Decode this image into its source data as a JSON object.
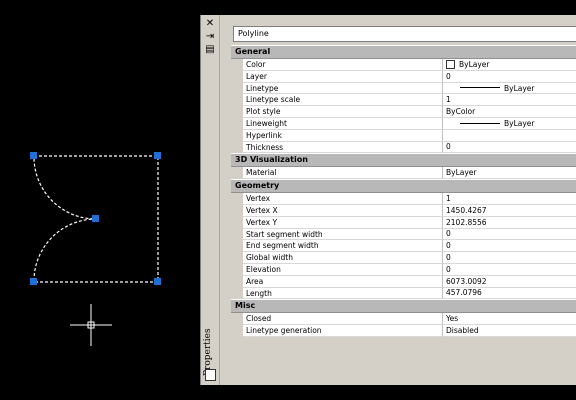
{
  "palette": {
    "title": "Properties",
    "object_type": "Polyline",
    "categories": [
      {
        "name": "General",
        "props": [
          {
            "name": "Color",
            "value": "ByLayer",
            "swatch": true
          },
          {
            "name": "Layer",
            "value": "0"
          },
          {
            "name": "Linetype",
            "value": "ByLayer",
            "line": true
          },
          {
            "name": "Linetype scale",
            "value": "1"
          },
          {
            "name": "Plot style",
            "value": "ByColor"
          },
          {
            "name": "Lineweight",
            "value": "ByLayer",
            "line": true
          },
          {
            "name": "Hyperlink",
            "value": ""
          },
          {
            "name": "Thickness",
            "value": "0"
          }
        ]
      },
      {
        "name": "3D Visualization",
        "props": [
          {
            "name": "Material",
            "value": "ByLayer"
          }
        ]
      },
      {
        "name": "Geometry",
        "props": [
          {
            "name": "Vertex",
            "value": "1"
          },
          {
            "name": "Vertex X",
            "value": "1450.4267"
          },
          {
            "name": "Vertex Y",
            "value": "2102.8556"
          },
          {
            "name": "Start segment width",
            "value": "0"
          },
          {
            "name": "End segment width",
            "value": "0"
          },
          {
            "name": "Global width",
            "value": "0"
          },
          {
            "name": "Elevation",
            "value": "0"
          },
          {
            "name": "Area",
            "value": "6073.0092"
          },
          {
            "name": "Length",
            "value": "457.0796"
          }
        ]
      },
      {
        "name": "Misc",
        "props": [
          {
            "name": "Closed",
            "value": "Yes"
          },
          {
            "name": "Linetype generation",
            "value": "Disabled"
          }
        ]
      }
    ]
  },
  "colors": {
    "canvas_bg": "#000000",
    "grip": "#1f6fd6",
    "polyline": "#ffffff"
  }
}
